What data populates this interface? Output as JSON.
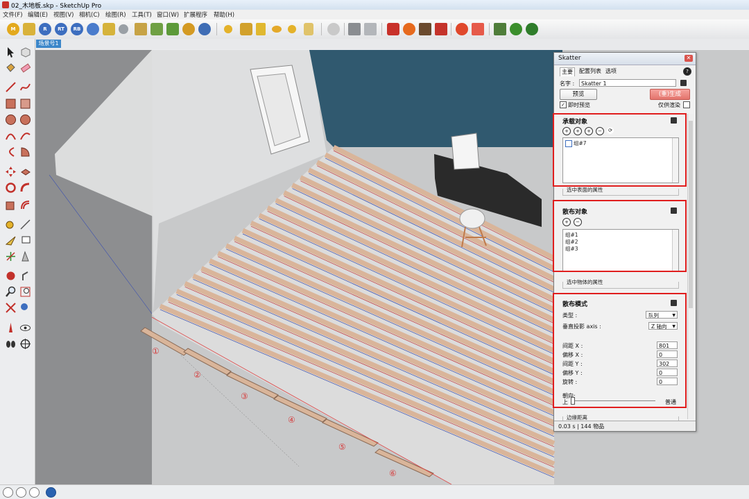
{
  "window": {
    "title": "02_木地板.skp - SketchUp Pro"
  },
  "menu": [
    "文件(F)",
    "编辑(E)",
    "视图(V)",
    "相机(C)",
    "绘图(R)",
    "工具(T)",
    "窗口(W)",
    "扩展程序",
    "帮助(H)"
  ],
  "scene_tab": "场景号1",
  "toolbar_glyphs": {
    "m": "M",
    "r": "R",
    "rt": "RT",
    "rb": "RB"
  },
  "skatter": {
    "title": "Skatter",
    "tabs": [
      "主要",
      "配置列表",
      "选项"
    ],
    "help_glyph": "?",
    "name_label": "名字 :",
    "name_value": "Skatter 1",
    "preview_button": "预览",
    "generate_button": "(重)生成",
    "instant_preview": {
      "label": "即时预览",
      "checked": true
    },
    "only_boundary": {
      "label": "仅供渲染",
      "checked": false
    },
    "host": {
      "heading": "承载对象",
      "items": [
        "组#7"
      ],
      "props_legend": "选中表面的属性"
    },
    "scatter_objects": {
      "heading": "散布对象",
      "items": [
        "组#1",
        "组#2",
        "组#3"
      ],
      "props_legend": "选中物体的属性"
    },
    "distribution": {
      "heading": "散布模式",
      "type_label": "类型 :",
      "type_value": "队列",
      "projection_label": "垂直投影 axis :",
      "projection_value": "Z 轴向",
      "fields": [
        {
          "label": "间距 X :",
          "value": "801"
        },
        {
          "label": "偏移 X :",
          "value": "0"
        },
        {
          "label": "间距 Y :",
          "value": "302"
        },
        {
          "label": "偏移 Y :",
          "value": "0"
        },
        {
          "label": "旋转 :",
          "value": "0"
        }
      ],
      "orientation_label": "朝向:",
      "orientation_left": "上",
      "orientation_right": "普通",
      "next_legend": "边缘距离"
    },
    "status": "0.03 s | 144 物品"
  },
  "callouts": [
    "①",
    "②",
    "③",
    "④",
    "⑤",
    "⑥"
  ],
  "colors": {
    "accent": "#e01e1e",
    "wall": "#2f5a73",
    "wood": "#d9b59a"
  }
}
